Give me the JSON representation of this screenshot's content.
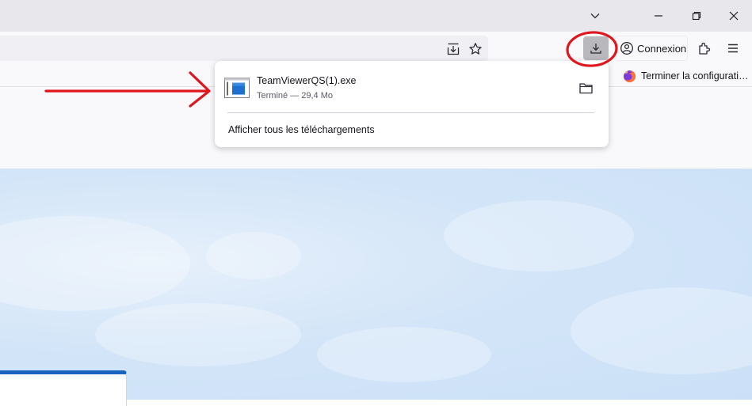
{
  "toolbar": {
    "connexion_label": "Connexion"
  },
  "bookmarks": {
    "item_label": "Terminer la configurati…"
  },
  "downloads_panel": {
    "file_name": "TeamViewerQS(1).exe",
    "file_status": "Terminé — 29,4 Mo",
    "show_all_label": "Afficher tous les téléchargements"
  },
  "icons": {
    "window": [
      "chevron-down-icon",
      "minimize-icon",
      "restore-icon",
      "close-icon"
    ],
    "urlbar": [
      "save-to-pocket-icon",
      "bookmark-star-icon"
    ],
    "toolbar": [
      "download-icon",
      "account-icon",
      "extensions-icon",
      "menu-icon"
    ],
    "panel": [
      "exe-file-icon",
      "folder-icon"
    ],
    "bookmark": "firefox-logo-icon"
  },
  "colors": {
    "annotation_red": "#e0161f",
    "download_button_active": "#b8b8bd",
    "hero_blue": "#cfe3f8",
    "card_border_blue": "#1a64c0"
  }
}
